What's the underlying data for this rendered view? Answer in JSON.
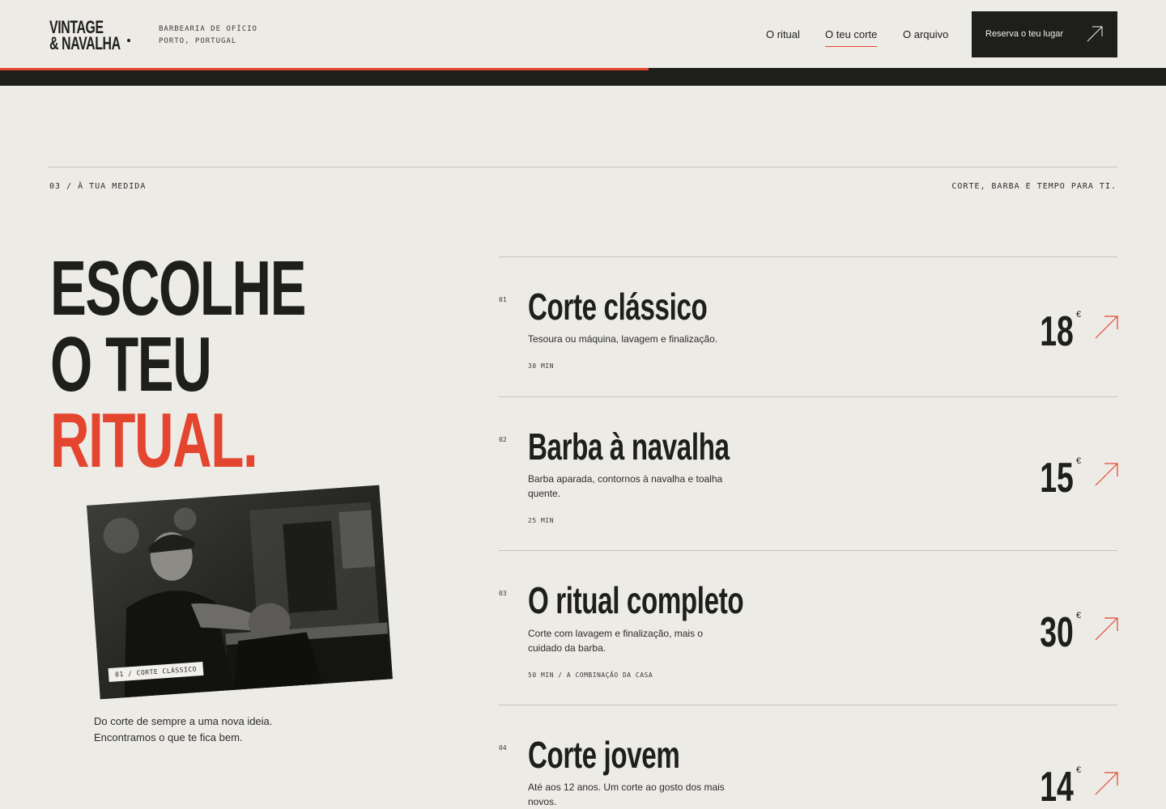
{
  "brand": {
    "line1": "VINTAGE",
    "line2": "& NAVALHA",
    "tagline1": "BARBEARIA DE OFÍCIO",
    "tagline2": "PORTO, PORTUGAL"
  },
  "nav": {
    "items": [
      {
        "label": "O ritual",
        "active": false
      },
      {
        "label": "O teu corte",
        "active": true
      },
      {
        "label": "O arquivo",
        "active": false
      }
    ],
    "cta_label": "Reserva o teu lugar"
  },
  "progress": {
    "fraction": 0.556
  },
  "section": {
    "label": "03 / À TUA MEDIDA",
    "aside": "CORTE, BARBA E TEMPO PARA TI."
  },
  "headline": {
    "line1": "ESCOLHE",
    "line2": "O TEU",
    "line3": "RITUAL."
  },
  "photo": {
    "tag": "01 / CORTE CLÁSSICO"
  },
  "intro": "Do corte de sempre a uma nova ideia. Encontramos o que te fica bem.",
  "services": [
    {
      "num": "01",
      "title": "Corte clássico",
      "desc": "Tesoura ou máquina, lavagem e finalização.",
      "meta": "30 MIN",
      "price": "18",
      "currency": "€"
    },
    {
      "num": "02",
      "title": "Barba à navalha",
      "desc": "Barba aparada, contornos à navalha e toalha quente.",
      "meta": "25 MIN",
      "price": "15",
      "currency": "€"
    },
    {
      "num": "03",
      "title": "O ritual completo",
      "desc": "Corte com lavagem e finalização, mais o cuidado da barba.",
      "meta": "50 MIN / A COMBINAÇÃO DA CASA",
      "price": "30",
      "currency": "€"
    },
    {
      "num": "04",
      "title": "Corte jovem",
      "desc": "Até aos 12 anos. Um corte ao gosto dos mais novos.",
      "meta": "",
      "price": "14",
      "currency": "€"
    }
  ],
  "colors": {
    "accent": "#e4452f",
    "ink": "#1e1e1c",
    "paper": "#edebe6"
  }
}
